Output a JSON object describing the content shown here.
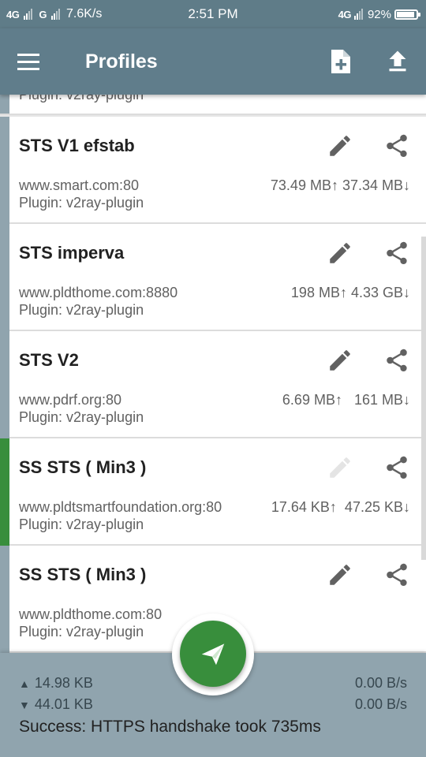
{
  "status_bar": {
    "network_1": "4G",
    "network_2": "G",
    "speed": "7.6K/s",
    "time": "2:51 PM",
    "network_right": "4G",
    "battery": "92%",
    "battery_level_percent": 92
  },
  "app_bar": {
    "title": "Profiles",
    "menu_icon": "hamburger-menu-icon",
    "add_icon": "add-profile-icon",
    "upload_icon": "upload-icon"
  },
  "partial_profile": {
    "plugin": "Plugin: v2ray-plugin"
  },
  "profiles": [
    {
      "name": "STS V1 efstab",
      "host": "www.smart.com:80",
      "plugin": "Plugin: v2ray-plugin",
      "traffic": "73.49 MB↑ 37.34 MB↓",
      "active": false
    },
    {
      "name": "STS imperva",
      "host": "www.pldthome.com:8880",
      "plugin": "Plugin: v2ray-plugin",
      "traffic": "198 MB↑ 4.33 GB↓",
      "active": false
    },
    {
      "name": "STS V2",
      "host": "www.pdrf.org:80",
      "plugin": "Plugin: v2ray-plugin",
      "traffic": "6.69 MB↑   161 MB↓",
      "active": false
    },
    {
      "name": "SS STS ( Min3 )",
      "host": "www.pldtsmartfoundation.org:80",
      "plugin": "Plugin: v2ray-plugin",
      "traffic": "17.64 KB↑  47.25 KB↓",
      "active": true
    },
    {
      "name": "SS STS ( Min3 )",
      "host": "www.pldthome.com:80",
      "plugin": "Plugin: v2ray-plugin",
      "traffic": "",
      "active": false
    }
  ],
  "stats": {
    "tx_arrow": "▲",
    "rx_arrow": "▼",
    "tx_total": "14.98 KB",
    "rx_total": "44.01 KB",
    "tx_rate": "0.00 B/s",
    "rx_rate": "0.00 B/s",
    "message": "Success: HTTPS handshake took 735ms"
  },
  "fab": {
    "icon": "paper-plane-icon"
  },
  "colors": {
    "app_bar": "#607d8b",
    "status_bar": "#5f7c88",
    "indicator_inactive": "#90a4ae",
    "indicator_active": "#388e3c",
    "fab": "#388e3c",
    "stats_bar": "#90a4ae"
  }
}
